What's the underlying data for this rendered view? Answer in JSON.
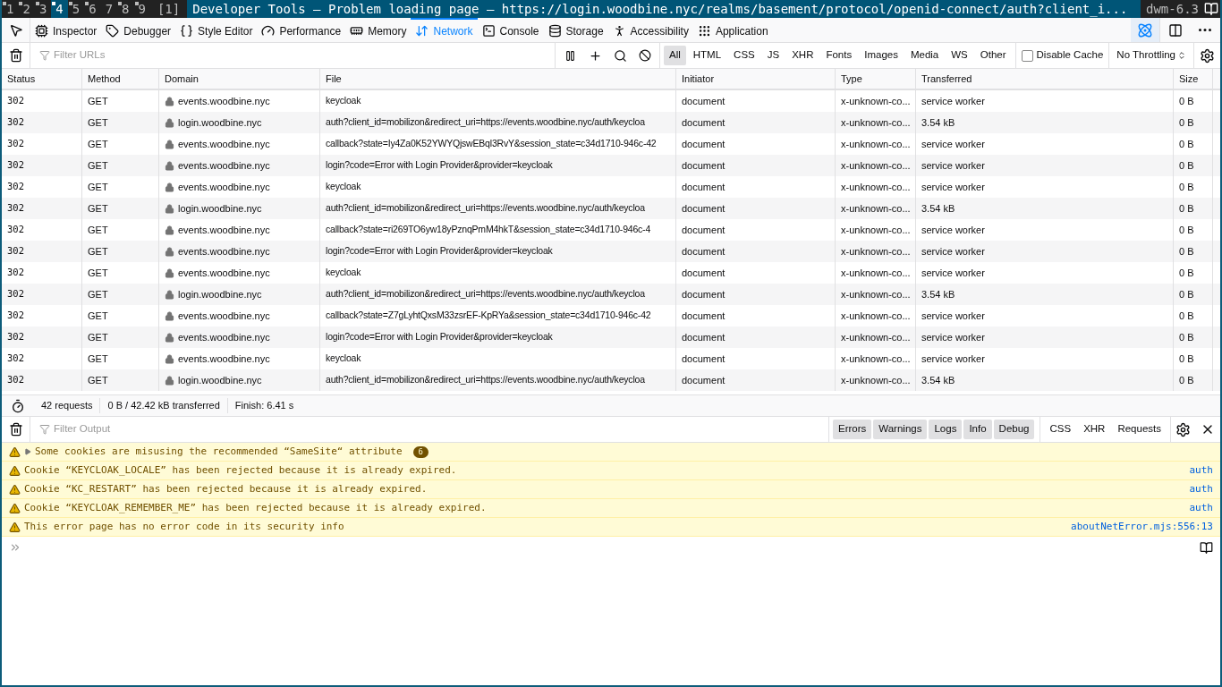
{
  "taskbar": {
    "tags": [
      {
        "label": "1",
        "selected": false,
        "occupied": true
      },
      {
        "label": "2",
        "selected": false,
        "occupied": true
      },
      {
        "label": "3",
        "selected": false,
        "occupied": true
      },
      {
        "label": "4",
        "selected": true,
        "occupied": true
      },
      {
        "label": "5",
        "selected": false,
        "occupied": true
      },
      {
        "label": "6",
        "selected": false,
        "occupied": true
      },
      {
        "label": "7",
        "selected": false,
        "occupied": false
      },
      {
        "label": "8",
        "selected": false,
        "occupied": true
      },
      {
        "label": "9",
        "selected": false,
        "occupied": true
      }
    ],
    "layout": "[1]",
    "title": "Developer Tools — Problem loading page — https://login.woodbine.nyc/realms/basement/protocol/openid-connect/auth?client_i...",
    "status": "dwm-6.3"
  },
  "tools": [
    {
      "label": "Inspector",
      "selected": false
    },
    {
      "label": "Debugger",
      "selected": false
    },
    {
      "label": "Style Editor",
      "selected": false
    },
    {
      "label": "Performance",
      "selected": false
    },
    {
      "label": "Memory",
      "selected": false
    },
    {
      "label": "Network",
      "selected": true
    },
    {
      "label": "Console",
      "selected": false
    },
    {
      "label": "Storage",
      "selected": false
    },
    {
      "label": "Accessibility",
      "selected": false
    },
    {
      "label": "Application",
      "selected": false
    }
  ],
  "network_toolbar": {
    "filter_placeholder": "Filter URLs",
    "types": [
      {
        "label": "All",
        "selected": true
      },
      {
        "label": "HTML",
        "selected": false
      },
      {
        "label": "CSS",
        "selected": false
      },
      {
        "label": "JS",
        "selected": false
      },
      {
        "label": "XHR",
        "selected": false
      },
      {
        "label": "Fonts",
        "selected": false
      },
      {
        "label": "Images",
        "selected": false
      },
      {
        "label": "Media",
        "selected": false
      },
      {
        "label": "WS",
        "selected": false
      },
      {
        "label": "Other",
        "selected": false
      }
    ],
    "disable_cache": {
      "label": "Disable Cache",
      "checked": false
    },
    "throttling": "No Throttling"
  },
  "table": {
    "columns": [
      "Status",
      "Method",
      "Domain",
      "File",
      "Initiator",
      "Type",
      "Transferred",
      "Size"
    ],
    "rows": [
      [
        "302",
        "GET",
        "events.woodbine.nyc",
        "keycloak",
        "document",
        "x-unknown-co...",
        "service worker",
        "0 B"
      ],
      [
        "302",
        "GET",
        "login.woodbine.nyc",
        "auth?client_id=mobilizon&redirect_uri=https://events.woodbine.nyc/auth/keycloa",
        "document",
        "x-unknown-co...",
        "3.54 kB",
        "0 B"
      ],
      [
        "302",
        "GET",
        "events.woodbine.nyc",
        "callback?state=Iy4Za0K52YWYQjswEBql3RvY&session_state=c34d1710-946c-42",
        "document",
        "x-unknown-co...",
        "service worker",
        "0 B"
      ],
      [
        "302",
        "GET",
        "events.woodbine.nyc",
        "login?code=Error with Login Provider&provider=keycloak",
        "document",
        "x-unknown-co...",
        "service worker",
        "0 B"
      ],
      [
        "302",
        "GET",
        "events.woodbine.nyc",
        "keycloak",
        "document",
        "x-unknown-co...",
        "service worker",
        "0 B"
      ],
      [
        "302",
        "GET",
        "login.woodbine.nyc",
        "auth?client_id=mobilizon&redirect_uri=https://events.woodbine.nyc/auth/keycloa",
        "document",
        "x-unknown-co...",
        "3.54 kB",
        "0 B"
      ],
      [
        "302",
        "GET",
        "events.woodbine.nyc",
        "callback?state=ri269TO6yw18yPznqPmM4hkT&session_state=c34d1710-946c-4",
        "document",
        "x-unknown-co...",
        "service worker",
        "0 B"
      ],
      [
        "302",
        "GET",
        "events.woodbine.nyc",
        "login?code=Error with Login Provider&provider=keycloak",
        "document",
        "x-unknown-co...",
        "service worker",
        "0 B"
      ],
      [
        "302",
        "GET",
        "events.woodbine.nyc",
        "keycloak",
        "document",
        "x-unknown-co...",
        "service worker",
        "0 B"
      ],
      [
        "302",
        "GET",
        "login.woodbine.nyc",
        "auth?client_id=mobilizon&redirect_uri=https://events.woodbine.nyc/auth/keycloa",
        "document",
        "x-unknown-co...",
        "3.54 kB",
        "0 B"
      ],
      [
        "302",
        "GET",
        "events.woodbine.nyc",
        "callback?state=Z7gLyhtQxsM33zsrEF-KpRYa&session_state=c34d1710-946c-42",
        "document",
        "x-unknown-co...",
        "service worker",
        "0 B"
      ],
      [
        "302",
        "GET",
        "events.woodbine.nyc",
        "login?code=Error with Login Provider&provider=keycloak",
        "document",
        "x-unknown-co...",
        "service worker",
        "0 B"
      ],
      [
        "302",
        "GET",
        "events.woodbine.nyc",
        "keycloak",
        "document",
        "x-unknown-co...",
        "service worker",
        "0 B"
      ],
      [
        "302",
        "GET",
        "login.woodbine.nyc",
        "auth?client_id=mobilizon&redirect_uri=https://events.woodbine.nyc/auth/keycloa",
        "document",
        "x-unknown-co...",
        "3.54 kB",
        "0 B"
      ]
    ]
  },
  "summary": [
    "42 requests",
    "0 B / 42.42 kB transferred",
    "Finish: 6.41 s"
  ],
  "console_toolbar": {
    "filter_placeholder": "Filter Output",
    "levels": [
      {
        "label": "Errors",
        "on": true
      },
      {
        "label": "Warnings",
        "on": true
      },
      {
        "label": "Logs",
        "on": true
      },
      {
        "label": "Info",
        "on": true
      },
      {
        "label": "Debug",
        "on": true
      }
    ],
    "categories": [
      {
        "label": "CSS",
        "on": false
      },
      {
        "label": "XHR",
        "on": false
      },
      {
        "label": "Requests",
        "on": false
      }
    ]
  },
  "messages": [
    {
      "kind": "group",
      "text": "Some cookies are misusing the recommended “SameSite“ attribute",
      "count": "6",
      "expanded": false
    },
    {
      "kind": "warning",
      "text": "Cookie “KEYCLOAK_LOCALE” has been rejected because it is already expired.",
      "source": "auth"
    },
    {
      "kind": "warning",
      "text": "Cookie “KC_RESTART” has been rejected because it is already expired.",
      "source": "auth"
    },
    {
      "kind": "warning",
      "text": "Cookie “KEYCLOAK_REMEMBER_ME” has been rejected because it is already expired.",
      "source": "auth"
    },
    {
      "kind": "warning",
      "text": "This error page has no error code in its security info",
      "source": "aboutNetError.mjs:556:13"
    }
  ]
}
